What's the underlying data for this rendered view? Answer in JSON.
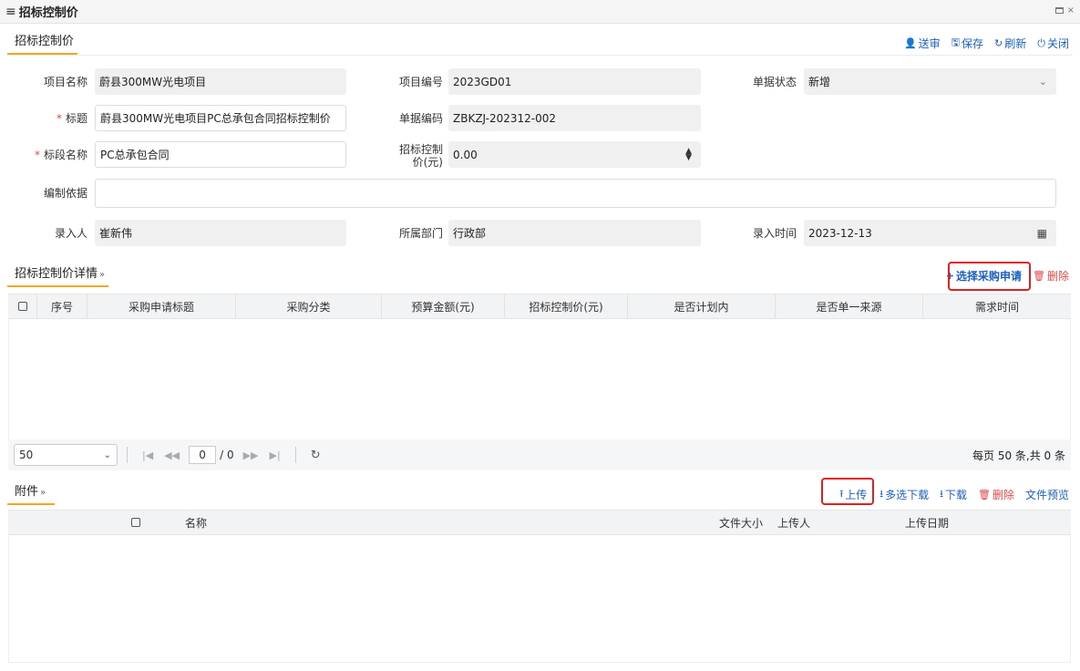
{
  "window": {
    "title": "招标控制价"
  },
  "main_tab": "招标控制价",
  "toolbar": {
    "submit": "送审",
    "save": "保存",
    "refresh": "刷新",
    "close": "关闭"
  },
  "form": {
    "project_name": {
      "label": "项目名称",
      "value": "蔚县300MW光电项目"
    },
    "project_no": {
      "label": "项目编号",
      "value": "2023GD01"
    },
    "doc_status": {
      "label": "单据状态",
      "value": "新增"
    },
    "title": {
      "label": "标题",
      "value": "蔚县300MW光电项目PC总承包合同招标控制价"
    },
    "doc_no": {
      "label": "单据编码",
      "value": "ZBKZJ-202312-002"
    },
    "section_name": {
      "label": "标段名称",
      "value": "PC总承包合同"
    },
    "control_price": {
      "label_1": "招标控制",
      "label_2": "价(元)",
      "value": "0.00"
    },
    "basis": {
      "label": "编制依据",
      "value": ""
    },
    "entered_by": {
      "label": "录入人",
      "value": "崔新伟"
    },
    "department": {
      "label": "所属部门",
      "value": "行政部"
    },
    "entry_time": {
      "label": "录入时间",
      "value": "2023-12-13"
    }
  },
  "details": {
    "tab": "招标控制价详情",
    "select_btn": "选择采购申请",
    "delete_btn": "删除",
    "columns": [
      "序号",
      "采购申请标题",
      "采购分类",
      "预算金额(元)",
      "招标控制价(元)",
      "是否计划内",
      "是否单一来源",
      "需求时间"
    ],
    "pager": {
      "page_size": "50",
      "current": "0",
      "total": "/ 0",
      "info": "每页 50 条,共 0 条"
    }
  },
  "attachments": {
    "tab": "附件",
    "upload": "上传",
    "multi_download": "多选下载",
    "download": "下载",
    "delete": "删除",
    "preview": "文件预览",
    "columns": [
      "名称",
      "文件大小",
      "上传人",
      "上传日期"
    ]
  }
}
